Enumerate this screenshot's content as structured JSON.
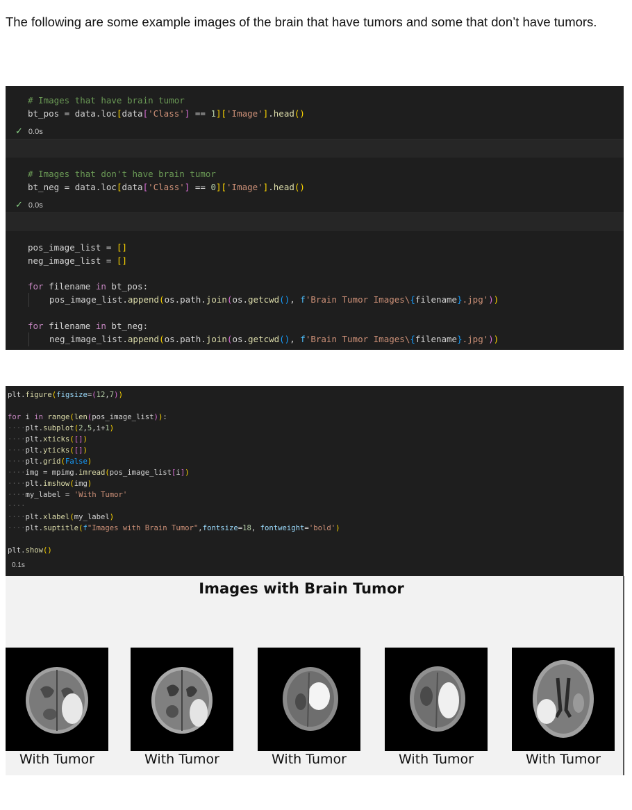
{
  "intro_text": "The following are some example images of the brain that have tumors and some that don’t have tumors.",
  "cell1": {
    "block1_comment": "# Images that have brain tumor",
    "block1_status": "0.0s",
    "block2_comment": "# Images that don't have brain tumor",
    "block2_status": "0.0s"
  },
  "cell2": {
    "exec_time": "0.1s"
  },
  "figure": {
    "title": "Images with Brain Tumor",
    "panels": [
      {
        "label": "With Tumor"
      },
      {
        "label": "With Tumor"
      },
      {
        "label": "With Tumor"
      },
      {
        "label": "With Tumor"
      },
      {
        "label": "With Tumor"
      }
    ]
  },
  "colors": {
    "editor_bg": "#1e1e1e",
    "comment": "#6a9955",
    "string": "#ce9178",
    "keyword": "#c586c0",
    "function": "#dcdcaa",
    "figure_bg": "#f2f2f2"
  }
}
